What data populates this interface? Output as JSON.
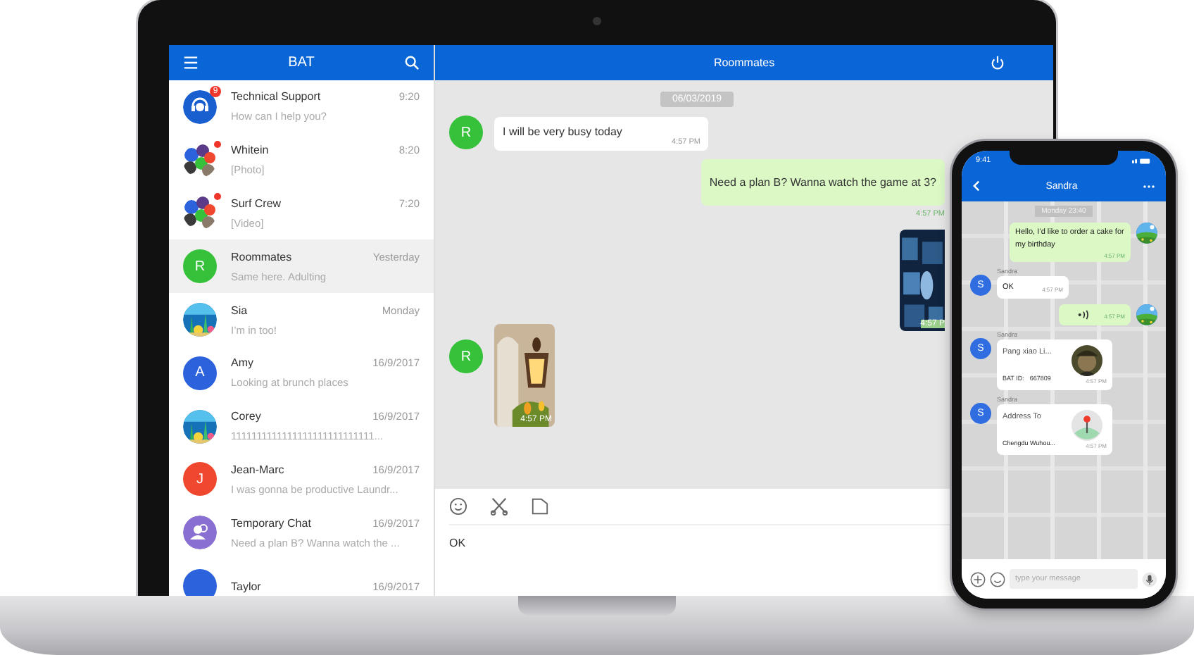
{
  "laptop": {
    "sidebar": {
      "title": "BAT",
      "chats": [
        {
          "name": "Technical Support",
          "time": "9:20",
          "preview": "How can I help you?",
          "avatar": {
            "kind": "support",
            "color": "#1a5fd0"
          },
          "badge": "9",
          "selected": false
        },
        {
          "name": "Whitein",
          "time": "8:20",
          "preview": "[Photo]",
          "avatar": {
            "kind": "collage"
          },
          "unread_dot": true,
          "selected": false
        },
        {
          "name": "Surf Crew",
          "time": "7:20",
          "preview": "[Video]",
          "avatar": {
            "kind": "collage"
          },
          "unread_dot": true,
          "selected": false
        },
        {
          "name": "Roommates",
          "time": "Yesterday",
          "preview": "Same here. Adulting",
          "avatar": {
            "kind": "letter",
            "letter": "R",
            "color": "#36c13a"
          },
          "selected": true
        },
        {
          "name": "Sia",
          "time": "Monday",
          "preview": "I’m in too!",
          "selected": false
        },
        {
          "name": "Amy",
          "time": "16/9/2017",
          "preview": "Looking at brunch places",
          "avatar": {
            "kind": "letter",
            "letter": "A",
            "color": "#2c62dc"
          },
          "selected": false
        },
        {
          "name": "Corey",
          "time": "16/9/2017",
          "preview": "1111111111111111111111111111...",
          "selected": false
        },
        {
          "name": "Jean-Marc",
          "time": "16/9/2017",
          "preview": "I was gonna be productive Laundr...",
          "avatar": {
            "kind": "letter",
            "letter": "J",
            "color": "#f0472f"
          },
          "selected": false
        },
        {
          "name": "Temporary Chat",
          "time": "16/9/2017",
          "preview": "Need a plan B? Wanna watch the ...",
          "avatar": {
            "kind": "group",
            "color": "#8a6fd2"
          },
          "selected": false
        },
        {
          "name": "Taylor",
          "time": "16/9/2017",
          "avatar": {
            "kind": "letter",
            "color": "#2c62dc"
          },
          "selected": false
        }
      ]
    },
    "chat": {
      "title": "Roommates",
      "date": "06/03/2019",
      "messages": [
        {
          "kind": "text",
          "outgoing": false,
          "avatar": "R",
          "text": "I will be very busy today",
          "time": "4:57 PM"
        },
        {
          "kind": "text",
          "outgoing": true,
          "text": "Need a plan B? Wanna watch the game at 3?",
          "time": "4:57 PM"
        },
        {
          "outgoing": true,
          "time": "4:57 P"
        },
        {
          "outgoing": false,
          "avatar": "R",
          "time": "4:57 PM"
        }
      ],
      "draft": "OK"
    }
  },
  "phone": {
    "status_time": "9:41",
    "title": "Sandra",
    "date": "Monday 23:40",
    "messages": [
      {
        "kind": "text",
        "outgoing": true,
        "text": "Hello, I’d like to order a cake for my birthday",
        "time": "4:57 PM"
      },
      {
        "kind": "text",
        "outgoing": false,
        "sender": "Sandra",
        "avatar": "S",
        "text": "OK",
        "time": "4:57 PM"
      },
      {
        "kind": "voice",
        "outgoing": true,
        "time": "4:57 PM"
      },
      {
        "kind": "contact",
        "outgoing": false,
        "sender": "Sandra",
        "avatar": "S",
        "name": "Pang xiao Li...",
        "id_label": "BAT ID:",
        "id": "667809",
        "time": "4:57 PM"
      },
      {
        "kind": "location",
        "outgoing": false,
        "sender": "Sandra",
        "avatar": "S",
        "title": "Address To",
        "address": "Chengdu Wuhou...",
        "time": "4:57 PM"
      }
    ],
    "placeholder": "type your message"
  }
}
